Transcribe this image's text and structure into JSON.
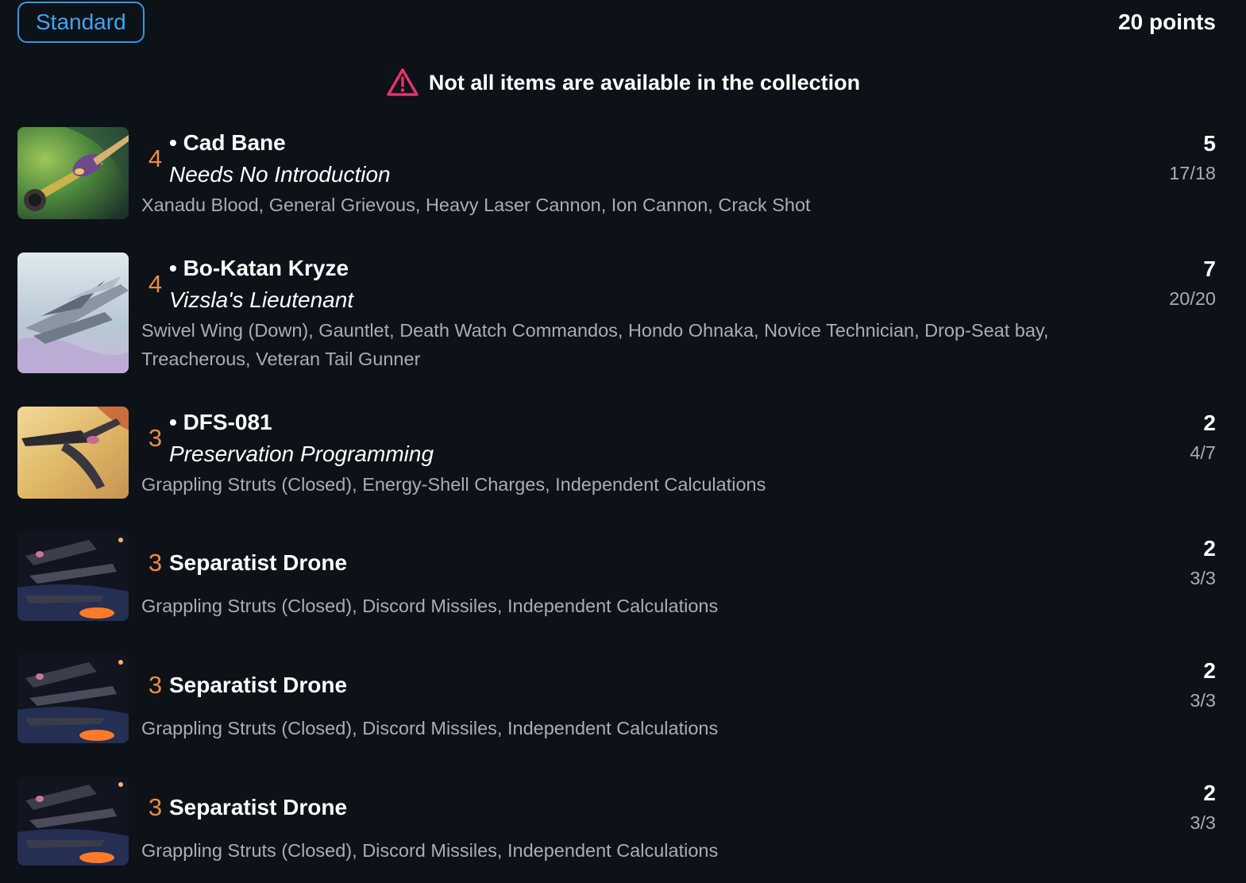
{
  "header": {
    "format_label": "Standard",
    "points_label": "20 points"
  },
  "warning": {
    "icon": "warning-triangle-icon",
    "text": "Not all items are available in the collection",
    "icon_color": "#e5336a"
  },
  "colors": {
    "background": "#0d1118",
    "accent_blue": "#2e9be8",
    "initiative_orange": "#f08a3c",
    "muted_text": "#a9adb7"
  },
  "ships": [
    {
      "initiative": "4",
      "pilot": "• Cad Bane",
      "subtitle": "Needs No Introduction",
      "upgrades": "Xanadu Blood, General Grievous, Heavy Laser Cannon, Ion Cannon, Crack Shot",
      "cost": "5",
      "loadout": "17/18",
      "image": "rogue-class-starfighter-image"
    },
    {
      "initiative": "4",
      "pilot": "• Bo-Katan Kryze",
      "subtitle": "Vizsla's Lieutenant",
      "upgrades": "Swivel Wing (Down), Gauntlet, Death Watch Commandos, Hondo Ohnaka, Novice Technician, Drop-Seat bay, Treacherous, Veteran Tail Gunner",
      "cost": "7",
      "loadout": "20/20",
      "image": "gauntlet-fighter-image"
    },
    {
      "initiative": "3",
      "pilot": "• DFS-081",
      "subtitle": "Preservation Programming",
      "upgrades": "Grappling Struts (Closed), Energy-Shell Charges, Independent Calculations",
      "cost": "2",
      "loadout": "4/7",
      "image": "vulture-droid-desert-image"
    },
    {
      "initiative": "3",
      "pilot": "Separatist Drone",
      "subtitle": "",
      "upgrades": "Grappling Struts (Closed), Discord Missiles, Independent Calculations",
      "cost": "2",
      "loadout": "3/3",
      "image": "vulture-droid-space-image"
    },
    {
      "initiative": "3",
      "pilot": "Separatist Drone",
      "subtitle": "",
      "upgrades": "Grappling Struts (Closed), Discord Missiles, Independent Calculations",
      "cost": "2",
      "loadout": "3/3",
      "image": "vulture-droid-space-image"
    },
    {
      "initiative": "3",
      "pilot": "Separatist Drone",
      "subtitle": "",
      "upgrades": "Grappling Struts (Closed), Discord Missiles, Independent Calculations",
      "cost": "2",
      "loadout": "3/3",
      "image": "vulture-droid-space-image"
    }
  ]
}
